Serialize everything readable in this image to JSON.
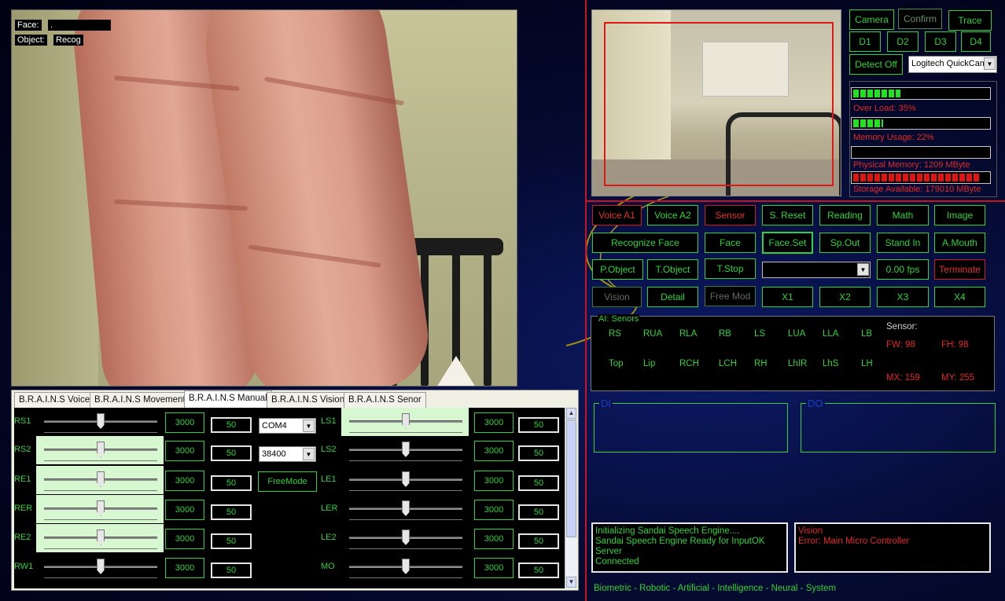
{
  "overlay": {
    "face_label": "Face:",
    "face_value": ".",
    "object_label": "Object:",
    "object_value": "Recog"
  },
  "tabs": [
    {
      "label": "B.R.A.I.N.S Voice"
    },
    {
      "label": "B.R.A.I.N.S Movement"
    },
    {
      "label": "B.R.A.I.N.S Manual",
      "active": true
    },
    {
      "label": "B.R.A.I.N.S Vision"
    },
    {
      "label": "B.R.A.I.N.S Senor"
    }
  ],
  "manual": {
    "left_rows": [
      {
        "label": "RS1",
        "value": "3000",
        "step": "50",
        "highlight": false,
        "level": 0.5
      },
      {
        "label": "RS2",
        "value": "3000",
        "step": "50",
        "highlight": true,
        "level": 0.5
      },
      {
        "label": "RE1",
        "value": "3000",
        "step": "50",
        "highlight": true,
        "level": 0.5
      },
      {
        "label": "RER",
        "value": "3000",
        "step": "50",
        "highlight": true,
        "level": 0.5
      },
      {
        "label": "RE2",
        "value": "3000",
        "step": "50",
        "highlight": true,
        "level": 0.5
      },
      {
        "label": "RW1",
        "value": "3000",
        "step": "50",
        "highlight": false,
        "level": 0.5
      }
    ],
    "right_rows": [
      {
        "label": "LS1",
        "value": "3000",
        "step": "50",
        "highlight": true,
        "level": 0.5
      },
      {
        "label": "LS2",
        "value": "3000",
        "step": "50",
        "highlight": false,
        "level": 0.5
      },
      {
        "label": "LE1",
        "value": "3000",
        "step": "50",
        "highlight": false,
        "level": 0.5
      },
      {
        "label": "LER",
        "value": "3000",
        "step": "50",
        "highlight": false,
        "level": 0.5
      },
      {
        "label": "LE2",
        "value": "3000",
        "step": "50",
        "highlight": false,
        "level": 0.5
      },
      {
        "label": "MO",
        "value": "3000",
        "step": "50",
        "highlight": false,
        "level": 0.5
      }
    ],
    "port": "COM4",
    "baud": "38400",
    "freemode_label": "FreeMode"
  },
  "camera": {
    "buttons": {
      "camera": "Camera",
      "confirm": "Confirm",
      "trace": "Trace",
      "d1": "D1",
      "d2": "D2",
      "d3": "D3",
      "d4": "D4",
      "detect": "Detect Off"
    },
    "device": "Logitech QuickCam"
  },
  "stats": {
    "overload_label": "Over Load: 35%",
    "overload": 0.35,
    "memory_label": "Memory Usage: 22%",
    "memory": 0.22,
    "physical_label": "Physical Memory: 1209 MByte",
    "physical": 0.0,
    "storage_label": "Storage Available: 179010 MByte",
    "storage": 0.93
  },
  "controls": {
    "voice_a1": "Voice A1",
    "voice_a2": "Voice A2",
    "sensor": "Sensor",
    "s_reset": "S. Reset",
    "reading": "Reading",
    "math": "Math",
    "image": "Image",
    "recognize_face": "Recognize Face",
    "face": "Face",
    "face_set": "Face.Set",
    "sp_out": "Sp.Out",
    "stand_in": "Stand In",
    "a_mouth": "A.Mouth",
    "p_object": "P.Object",
    "t_object": "T.Object",
    "t_stop": "T.Stop",
    "fps": "0.00 fps",
    "terminate": "Terminate",
    "vision": "Vision",
    "detail": "Detail",
    "free_mod": "Free Mod",
    "x1": "X1",
    "x2": "X2",
    "x3": "X3",
    "x4": "X4"
  },
  "sensors": {
    "title": "AI: Senors",
    "row1": [
      "RS",
      "RUA",
      "RLA",
      "RB",
      "LS",
      "LUA",
      "LLA",
      "LB"
    ],
    "row2": [
      "Top",
      "Lip",
      "RCH",
      "LCH",
      "RH",
      "LhIR",
      "LhS",
      "LH"
    ],
    "sensor_label": "Sensor:",
    "fw": "FW: 98",
    "fh": "FH: 98",
    "mx": "MX: 159",
    "my": "MY: 255"
  },
  "io": {
    "di_title": "DI",
    "do_title": "DO"
  },
  "log_left": [
    "Initializing Sandai Speech Engine....",
    "Sandai Speech Engine Ready for InputOK Server",
    "Connected"
  ],
  "log_right": [
    "Vision",
    " Error: Main Micro Controller"
  ],
  "footer": "Biometric - Robotic - Artificial - Intelligence - Neural - System",
  "colors": {
    "accent_green": "#2fd23a",
    "alert_red": "#e02828",
    "background": "#050a30"
  }
}
